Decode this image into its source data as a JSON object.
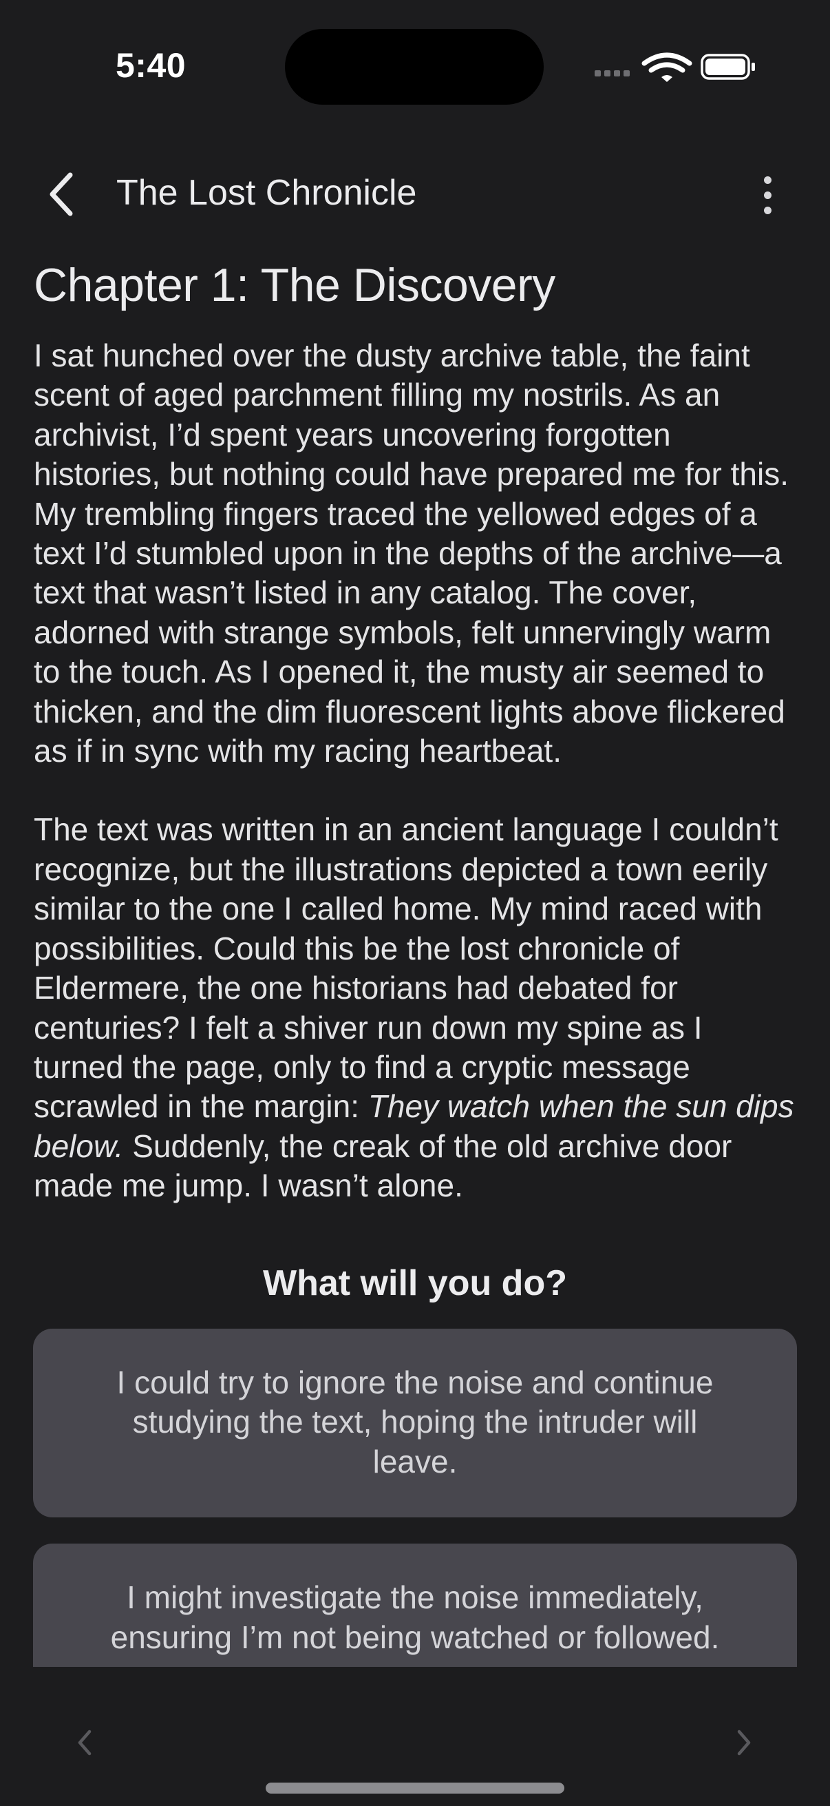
{
  "status_bar": {
    "time": "5:40",
    "icons": [
      "cellular-icon",
      "wifi-icon",
      "battery-icon"
    ]
  },
  "nav": {
    "title": "The Lost Chronicle",
    "back_icon": "chevron-left-icon",
    "more_icon": "more-vertical-icon"
  },
  "chapter": {
    "title": "Chapter 1: The Discovery",
    "paragraph1": "I sat hunched over the dusty archive table, the faint scent of aged parchment filling my nostrils. As an archivist, I’d spent years uncovering forgotten histories, but nothing could have prepared me for this. My trembling fingers traced the yellowed edges of a text I’d stumbled upon in the depths of the archive—a text that wasn’t listed in any catalog. The cover, adorned with strange symbols, felt unnervingly warm to the touch. As I opened it, the musty air seemed to thicken, and the dim fluorescent lights above flickered as if in sync with my racing heartbeat.",
    "paragraph2_start": "The text was written in an ancient language I couldn’t recognize, but the illustrations depicted a town eerily similar to the one I called home. My mind raced with possibilities. Could this be the lost chronicle of Eldermere, the one historians had debated for centuries? I felt a shiver run down my spine as I turned the page, only to find a cryptic message scrawled in the margin: ",
    "paragraph2_italic": "They watch when the sun dips below.",
    "paragraph2_end": " Suddenly, the creak of the old archive door made me jump. I wasn’t alone."
  },
  "prompt": "What will you do?",
  "choices": [
    {
      "text": "I could try to ignore the noise and continue studying the text, hoping the intruder will leave."
    },
    {
      "text": "I might investigate the noise immediately, ensuring I’m not being watched or followed."
    }
  ],
  "pager": {
    "prev_icon": "chevron-left-icon",
    "next_icon": "chevron-right-icon"
  },
  "colors": {
    "background": "#1c1c1e",
    "choice_background": "#48474e",
    "text": "#e4e4e6"
  }
}
